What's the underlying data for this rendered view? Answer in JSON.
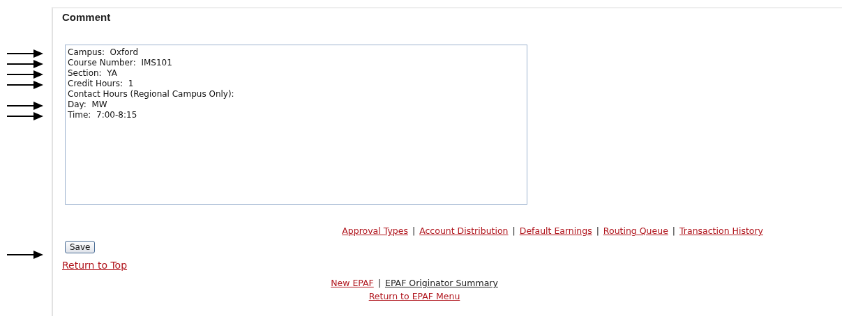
{
  "section": {
    "title": "Comment"
  },
  "comment": {
    "lines": [
      {
        "text": "Campus:  Oxford",
        "marked": true
      },
      {
        "text": "Course Number:  IMS101",
        "marked": true
      },
      {
        "text": "Section:  YA",
        "marked": true
      },
      {
        "text": "Credit Hours:  1",
        "marked": true
      },
      {
        "text": "Contact Hours (Regional Campus Only):",
        "marked": false
      },
      {
        "text": "Day:  MW",
        "marked": true
      },
      {
        "text": "Time:  7:00-8:15",
        "marked": true
      }
    ]
  },
  "nav_links": [
    {
      "label": "Approval Types"
    },
    {
      "separator": "|",
      "label": "Account Distribution"
    },
    {
      "separator": "|",
      "label": "Default Earnings"
    },
    {
      "separator": "|",
      "label": "Routing Queue"
    },
    {
      "separator": "|",
      "label": "Transaction History"
    }
  ],
  "save_button": {
    "label": "Save",
    "marked": true
  },
  "return_top": "Return to Top",
  "footer_links": [
    {
      "label": "New EPAF",
      "visited": false
    },
    {
      "separator": "|",
      "label": "EPAF Originator Summary",
      "visited": true
    }
  ],
  "footer_menu": "Return to EPAF Menu"
}
